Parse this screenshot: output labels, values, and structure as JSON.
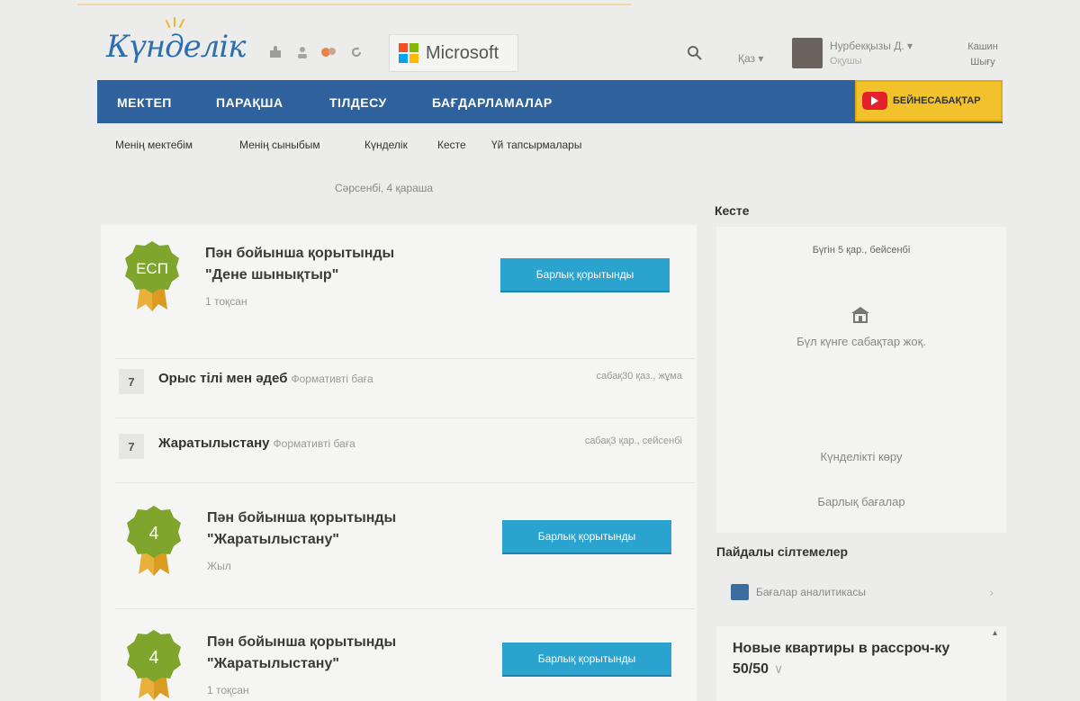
{
  "header": {
    "logo": "Күнделік",
    "microsoft_label": "Microsoft",
    "lang": "Қаз ▾",
    "user_name": "Нурбекқызы Д. ▾",
    "user_role": "Оқушы",
    "exit_line1": "Кашин",
    "exit_line2": "Шығу"
  },
  "nav": {
    "items": [
      "МЕКТЕП",
      "ПАРАҚША",
      "ТІЛДЕСУ",
      "БАҒДАРЛАМАЛАР"
    ],
    "video_label": "БЕЙНЕСАБАҚТАР"
  },
  "subnav": [
    "Менің мектебім",
    "Менің сыныбым",
    "Күнделік",
    "Кесте",
    "Үй тапсырмалары"
  ],
  "feed": {
    "date": "Сәрсенбі, 4 қараша",
    "cards": [
      {
        "badge": "ЕСП",
        "title1": "Пән бойынша қорытынды",
        "title2": "\"Дене шынықтыр\"",
        "sub": "1 тоқсан",
        "button": "Барлық қорытынды"
      },
      {
        "badge": "4",
        "title1": "Пән бойынша қорытынды",
        "title2": "\"Жаратылыстану\"",
        "sub": "Жыл",
        "button": "Барлық қорытынды"
      },
      {
        "badge": "4",
        "title1": "Пән бойынша қорытынды",
        "title2": "\"Жаратылыстану\"",
        "sub": "1 тоқсан",
        "button": "Барлық қорытынды"
      }
    ],
    "marks": [
      {
        "value": "7",
        "subject": "Орыс тілі мен әдеб",
        "type": "Формативті баға",
        "date": "сабақ30 қаз., жұма"
      },
      {
        "value": "7",
        "subject": "Жаратылыстану",
        "type": "Формативті баға",
        "date": "сабақ3 қар., сейсенбі"
      }
    ]
  },
  "sidebar": {
    "schedule_title": "Кесте",
    "schedule_date": "Бүгін 5 қар., бейсенбі",
    "no_lessons": "Бүл күнге сабақтар жоқ.",
    "view_diary": "Күнделікті көру",
    "all_marks": "Барлық бағалар",
    "links_title": "Пайдалы сілтемелер",
    "link_label": "Бағалар аналитикасы",
    "ad_text": "Новые квартиры в рассроч-ку 50/50"
  },
  "colors": {
    "nav_bg": "#2f629d",
    "button_bg": "#2aa3cf",
    "badge_green": "#7fa52c",
    "video_btn": "#f2c22c"
  }
}
